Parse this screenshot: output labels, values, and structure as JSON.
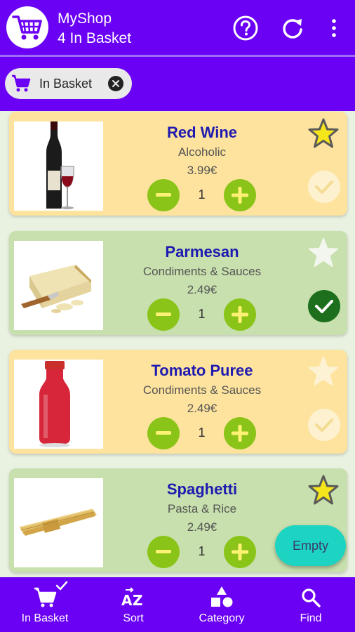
{
  "app": {
    "title": "MyShop",
    "subtitle": "4 In Basket"
  },
  "actions": {
    "help_icon": "help-circle-icon",
    "refresh_icon": "refresh-icon",
    "more_icon": "more-vert-icon"
  },
  "filter_chip": {
    "label": "In Basket"
  },
  "products": [
    {
      "name": "Red Wine",
      "category": "Alcoholic",
      "price": "3.99€",
      "quantity": "1",
      "favorite": true,
      "checked": false,
      "color": "yellow"
    },
    {
      "name": "Parmesan",
      "category": "Condiments & Sauces",
      "price": "2.49€",
      "quantity": "1",
      "favorite": false,
      "checked": true,
      "color": "green"
    },
    {
      "name": "Tomato Puree",
      "category": "Condiments & Sauces",
      "price": "2.49€",
      "quantity": "1",
      "favorite": false,
      "checked": false,
      "color": "yellow"
    },
    {
      "name": "Spaghetti",
      "category": "Pasta & Rice",
      "price": "2.49€",
      "quantity": "1",
      "favorite": true,
      "checked": false,
      "color": "green"
    }
  ],
  "fab": {
    "label": "Empty"
  },
  "bottom_nav": [
    {
      "label": "In Basket",
      "icon": "cart-check-icon"
    },
    {
      "label": "Sort",
      "icon": "sort-az-icon"
    },
    {
      "label": "Category",
      "icon": "shapes-icon"
    },
    {
      "label": "Find",
      "icon": "search-icon"
    }
  ],
  "colors": {
    "primary": "#6a00f4",
    "card_yellow": "#fde39d",
    "card_green": "#c7e0ad",
    "qty_button": "#8bc418",
    "star_favorite": "#f5e51b",
    "check_on": "#1d6e1d",
    "fab": "#1dd4c3",
    "product_name": "#1f1ab0"
  }
}
